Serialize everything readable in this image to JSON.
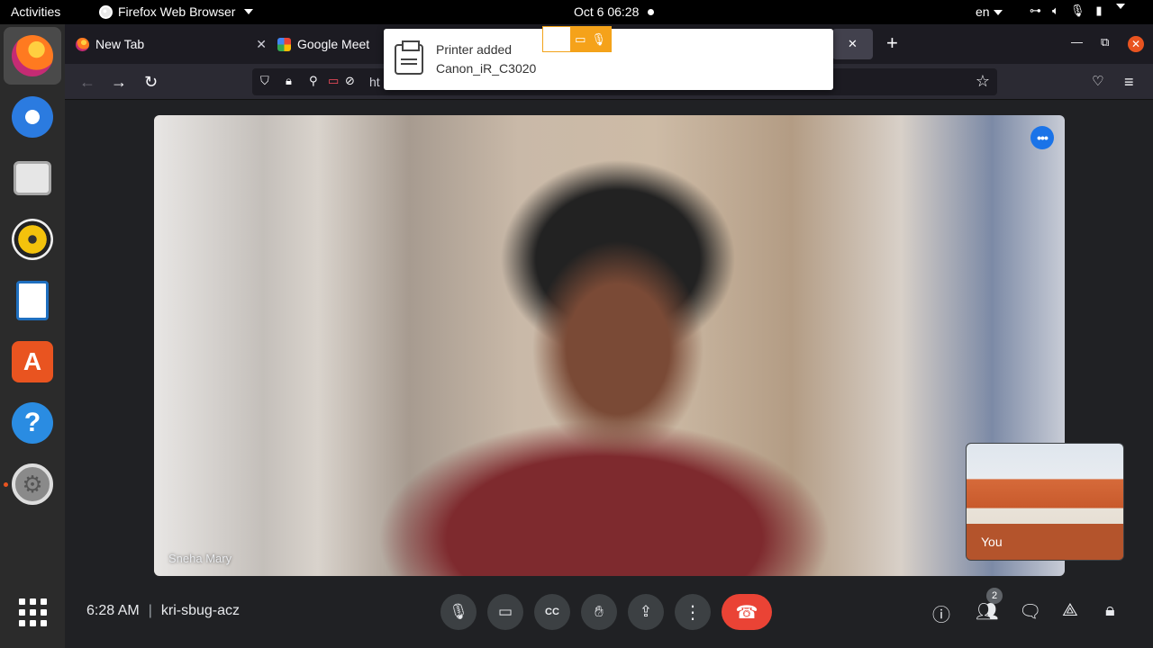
{
  "topbar": {
    "activities": "Activities",
    "app_name": "Firefox Web Browser",
    "datetime": "Oct 6  06:28",
    "language": "en"
  },
  "tabs": [
    {
      "label": "New Tab",
      "favicon": "firefox-icon"
    },
    {
      "label": "Google Meet",
      "favicon": "meet-icon"
    }
  ],
  "urlbar": {
    "text": "ht"
  },
  "notification": {
    "title": "Printer added",
    "body": "Canon_iR_C3020"
  },
  "meet": {
    "participant_name": "Sneha Mary",
    "self_label": "You",
    "time": "6:28 AM",
    "separator": "|",
    "meeting_code": "kri-sbug-acz",
    "participants_count": "2"
  },
  "colors": {
    "hangup": "#ea4335",
    "accent": "#1a73e8",
    "dock_running": "#e95420"
  }
}
